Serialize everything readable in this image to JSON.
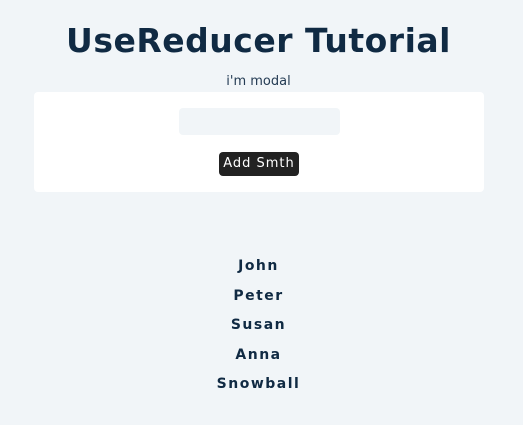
{
  "header": {
    "title": "UseReducer Tutorial"
  },
  "modal": {
    "text": "i'm modal"
  },
  "form": {
    "input_value": "",
    "input_placeholder": "",
    "button_label": "Add Smth"
  },
  "people": [
    {
      "name": "John"
    },
    {
      "name": "Peter"
    },
    {
      "name": "Susan"
    },
    {
      "name": "Anna"
    },
    {
      "name": "Snowball"
    }
  ],
  "colors": {
    "background": "#f1f5f8",
    "heading": "#102a43",
    "button": "#222222",
    "card": "#ffffff"
  }
}
